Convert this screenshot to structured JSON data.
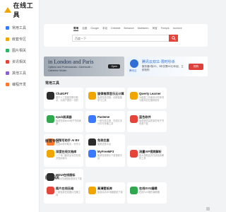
{
  "app": {
    "logo_text": "在线工具"
  },
  "sidebar": {
    "items": [
      {
        "label": "常用工具",
        "color": "#3a7afe"
      },
      {
        "label": "嵌套专区",
        "color": "#f0a500"
      },
      {
        "label": "图片相关",
        "color": "#2fb36c"
      },
      {
        "label": "资讯相关",
        "color": "#e5443a"
      },
      {
        "label": "其他工具",
        "color": "#8a63d2"
      },
      {
        "label": "编程开发",
        "color": "#ff7a2f"
      }
    ]
  },
  "search": {
    "engines": [
      "常用",
      "百度",
      "Google",
      "本站",
      "Dribbble",
      "Behance",
      "Mathkeen",
      "淘宝",
      "Freepik",
      "Iconfont"
    ],
    "active_index": 0,
    "placeholder": "百度一下"
  },
  "banners": {
    "left": {
      "title": "in London and Paris",
      "subtitle": "Options and Professionals • Dartmouth • Catherine Mullen",
      "button": "Open"
    },
    "right": {
      "logo_text": "腾讯云",
      "title": "腾讯云双11·限时秒杀",
      "subtitle": "服务器2核2G，3年仅需99元/年起，立即抢购",
      "button": "抢购"
    }
  },
  "sections": [
    {
      "title": "常用工具",
      "cards": [
        {
          "name": "ChatGPT",
          "desc": "基于人工智能的聊天助手，为用户提供一流的",
          "color": "#2b2b2b"
        },
        {
          "name": "旋律推荐音乐云计算",
          "desc": "免费在线试用，创新智能学习工具",
          "color": "#f0a500"
        },
        {
          "name": "Qwerty Learner",
          "desc": "为键盘工作者设计的单词与肌肉记忆锻炼软件",
          "color": "#f0a500"
        },
        {
          "name": "epub阅读器",
          "desc": "免费在线epub电子书阅读器",
          "color": "#2fa84f"
        },
        {
          "name": "Pasteme",
          "desc": "一款无需注册、在线文本分享与传输工具",
          "color": "#3a7afe"
        },
        {
          "name": "蓝色软件",
          "desc": "免费提供高质量的电子书资源下载",
          "color": "#e5443a"
        },
        {
          "name": "AI帮写助手 AI BV",
          "desc": "在线AI帮写助手，写作小助手",
          "color": "#ff7a2f"
        },
        {
          "name": "免税优惠",
          "desc": "免税优惠平台",
          "color": "#2b2b2b"
        }
      ]
    },
    {
      "title": "嵌套专区",
      "cards": [
        {
          "name": "深度在线文档库",
          "desc": "一个专门面向站长的在线文档阅读与",
          "color": "#f0a500"
        },
        {
          "name": "MyFreeMP3",
          "desc": "免费在线音乐下载搜索平台",
          "color": "#3a7afe"
        },
        {
          "name": "流量VIP视频解析",
          "desc": "各大视频会员在线免费解析工具",
          "color": "#e5443a"
        },
        {
          "name": "MDUI在线图标",
          "desc": "MDUI在线图标查找与下载",
          "color": "#2b2b2b"
        }
      ]
    },
    {
      "title": "图片相关",
      "cards": [
        {
          "name": "图片在线压缩",
          "desc": "一款免费在线图片压缩工具",
          "color": "#e5443a"
        },
        {
          "name": "高清壁纸库",
          "desc": "免费高清4K电脑壁纸下载",
          "color": "#f0a500"
        },
        {
          "name": "在线SVG编辑",
          "desc": "在线SVG图形编辑器",
          "color": "#2fa84f"
        }
      ]
    }
  ]
}
